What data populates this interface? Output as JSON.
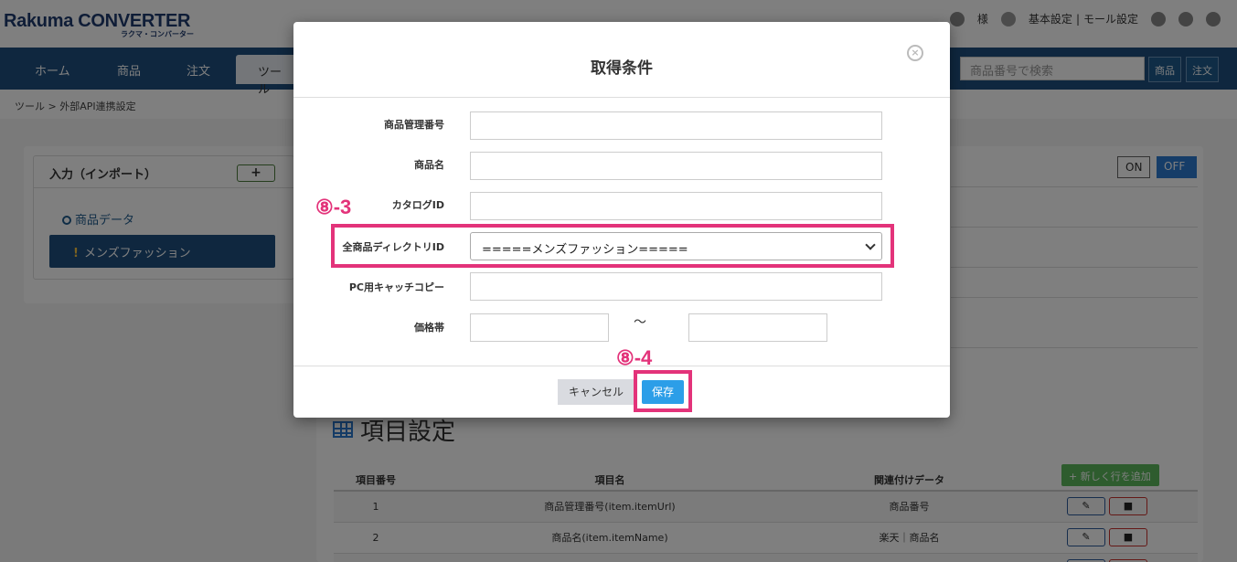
{
  "header": {
    "logo_main": "Rakuma CONVERTER",
    "logo_sub": "ラクマ・コンバーター",
    "user_suffix": "様",
    "basic_settings": "基本設定",
    "separator": "|",
    "mall_settings": "モール設定"
  },
  "nav": {
    "items": [
      "ホーム",
      "商品",
      "注文",
      "ツール"
    ],
    "search_placeholder": "商品番号で検索",
    "btn_product": "商品",
    "btn_order": "注文"
  },
  "breadcrumb": "ツール > 外部API連携設定",
  "left_panel": {
    "title": "入力（インポート）",
    "add_label": "+",
    "product_data": "商品データ",
    "selected_item": "メンズファッション",
    "selected_marker": "!"
  },
  "toggle": {
    "on": "ON",
    "off": "OFF"
  },
  "section": {
    "title": "項目設定",
    "add_row": "+ 新しく行を追加"
  },
  "table": {
    "headers": [
      "項目番号",
      "項目名",
      "関連付けデータ",
      ""
    ],
    "rows": [
      {
        "no": "1",
        "name": "商品管理番号(item.itemUrl)",
        "data": "商品番号"
      },
      {
        "no": "2",
        "name": "商品名(item.itemName)",
        "data": "楽天｜商品名"
      }
    ]
  },
  "modal": {
    "title": "取得条件",
    "close": "×",
    "fields": {
      "item_mgmt_no": "商品管理番号",
      "item_name": "商品名",
      "catalog_id": "カタログID",
      "directory_id": "全商品ディレクトリID",
      "pc_catch": "PC用キャッチコピー",
      "price_range": "価格帯"
    },
    "directory_value": "=====メンズファッション=====",
    "tilde": "〜",
    "cancel": "キャンセル",
    "save": "保存"
  },
  "annotations": {
    "label_83": "⑧-3",
    "label_84": "⑧-4",
    "color": "#e3337a"
  }
}
